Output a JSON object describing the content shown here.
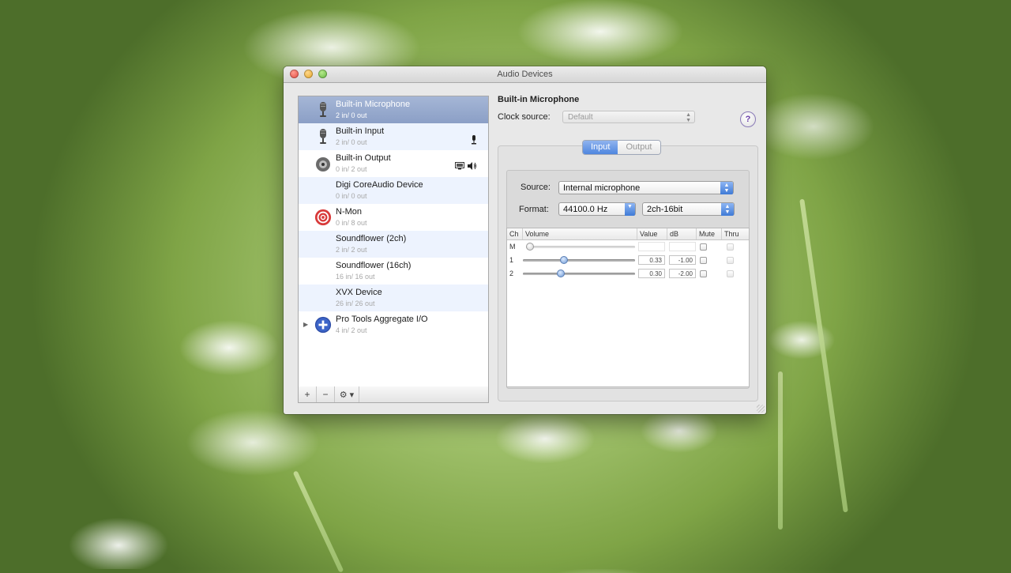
{
  "window": {
    "title": "Audio Devices"
  },
  "devices": [
    {
      "name": "Built-in Microphone",
      "io": "2 in/ 0 out",
      "icon": "microphone-icon",
      "selected": true
    },
    {
      "name": "Built-in Input",
      "io": "2 in/ 0 out",
      "icon": "microphone-icon",
      "status_icons": [
        "input-mic-icon"
      ]
    },
    {
      "name": "Built-in Output",
      "io": "0 in/ 2 out",
      "icon": "speaker-icon",
      "status_icons": [
        "system-output-icon",
        "volume-icon"
      ]
    },
    {
      "name": "Digi CoreAudio Device",
      "io": "0 in/ 0 out",
      "icon": ""
    },
    {
      "name": "N-Mon",
      "io": "0 in/ 8 out",
      "icon": "target-icon"
    },
    {
      "name": "Soundflower (2ch)",
      "io": "2 in/ 2 out",
      "icon": ""
    },
    {
      "name": "Soundflower (16ch)",
      "io": "16 in/ 16 out",
      "icon": ""
    },
    {
      "name": "XVX Device",
      "io": "26 in/ 26 out",
      "icon": ""
    },
    {
      "name": "Pro Tools Aggregate I/O",
      "io": "4 in/ 2 out",
      "icon": "aggregate-plus-icon"
    }
  ],
  "list_footer": {
    "add": "+",
    "remove": "−",
    "gear": "⚙ ▾"
  },
  "detail": {
    "device_title": "Built-in Microphone",
    "clock_label": "Clock source:",
    "clock_value": "Default",
    "help": "?",
    "tabs": [
      {
        "label": "Input",
        "active": true
      },
      {
        "label": "Output",
        "active": false
      }
    ],
    "source_label": "Source:",
    "source_value": "Internal microphone",
    "format_label": "Format:",
    "format_rate": "44100.0 Hz",
    "format_bits": "2ch-16bit",
    "table": {
      "headers": [
        "Ch",
        "Volume",
        "Value",
        "dB",
        "Mute",
        "Thru"
      ],
      "rows": [
        {
          "ch": "M",
          "level": 0.0,
          "value": "",
          "db": "",
          "enabled": false
        },
        {
          "ch": "1",
          "level": 0.33,
          "value": "0.33",
          "db": "-1.00",
          "enabled": true
        },
        {
          "ch": "2",
          "level": 0.3,
          "value": "0.30",
          "db": "-2.00",
          "enabled": true
        }
      ]
    }
  },
  "colors": {
    "selection": "#8b9fc6",
    "accent": "#4f86df",
    "help": "#6a3ea8"
  }
}
